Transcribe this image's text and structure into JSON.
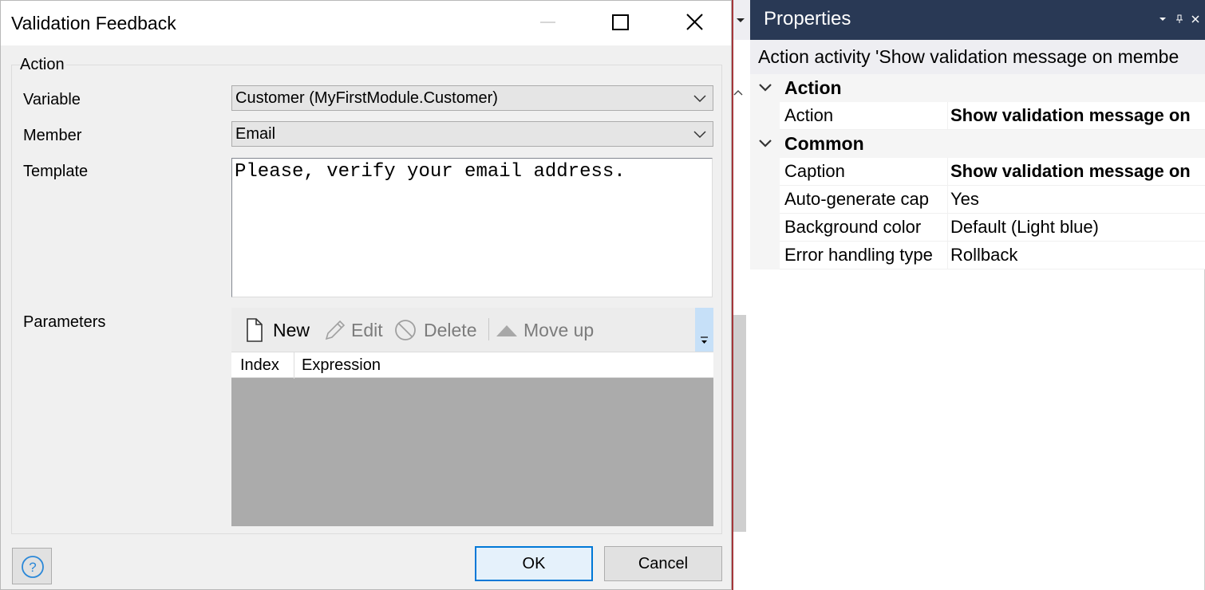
{
  "dialog": {
    "title": "Validation Feedback",
    "window_controls": {
      "minimize": "minimize-icon",
      "maximize": "maximize-icon",
      "close": "close-icon"
    },
    "group_label": "Action",
    "fields": {
      "variable": {
        "label": "Variable",
        "value": "Customer (MyFirstModule.Customer)"
      },
      "member": {
        "label": "Member",
        "value": "Email"
      },
      "template": {
        "label": "Template",
        "value": "Please, verify your email address."
      },
      "parameters": {
        "label": "Parameters"
      }
    },
    "parameters_toolbar": {
      "new": "New",
      "edit": "Edit",
      "delete": "Delete",
      "move_up": "Move up"
    },
    "parameters_grid": {
      "columns": [
        "Index",
        "Expression"
      ],
      "rows": []
    },
    "buttons": {
      "help": "help-icon",
      "ok": "OK",
      "cancel": "Cancel"
    }
  },
  "properties": {
    "title": "Properties",
    "subtitle": "Action activity 'Show validation message on membe",
    "categories": [
      {
        "name": "Action",
        "rows": [
          {
            "name": "Action",
            "value": "Show validation message on"
          }
        ]
      },
      {
        "name": "Common",
        "rows": [
          {
            "name": "Caption",
            "value": "Show validation message on"
          },
          {
            "name": "Auto-generate cap",
            "value": "Yes"
          },
          {
            "name": "Background color",
            "value": "Default (Light blue)"
          },
          {
            "name": "Error handling type",
            "value": "Rollback"
          }
        ]
      }
    ]
  },
  "colors": {
    "properties_header": "#293955",
    "ok_border": "#0078d7",
    "dialog_bg": "#f0f0f0",
    "grid_bg": "#ababab"
  }
}
